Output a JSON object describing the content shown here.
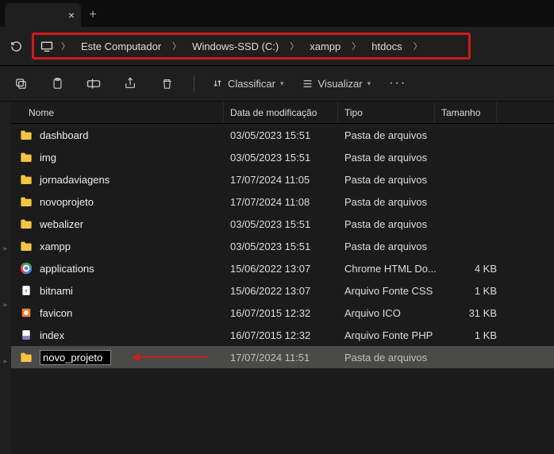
{
  "breadcrumbs": {
    "items": [
      "Este Computador",
      "Windows-SSD (C:)",
      "xampp",
      "htdocs"
    ]
  },
  "toolbar": {
    "sort_label": "Classificar",
    "view_label": "Visualizar"
  },
  "columns": {
    "name": "Nome",
    "date": "Data de modificação",
    "type": "Tipo",
    "size": "Tamanho"
  },
  "rows": [
    {
      "kind": "folder",
      "name": "dashboard",
      "date": "03/05/2023 15:51",
      "type": "Pasta de arquivos",
      "size": ""
    },
    {
      "kind": "folder",
      "name": "img",
      "date": "03/05/2023 15:51",
      "type": "Pasta de arquivos",
      "size": ""
    },
    {
      "kind": "folder",
      "name": "jornadaviagens",
      "date": "17/07/2024 11:05",
      "type": "Pasta de arquivos",
      "size": ""
    },
    {
      "kind": "folder",
      "name": "novoprojeto",
      "date": "17/07/2024 11:08",
      "type": "Pasta de arquivos",
      "size": ""
    },
    {
      "kind": "folder",
      "name": "webalizer",
      "date": "03/05/2023 15:51",
      "type": "Pasta de arquivos",
      "size": ""
    },
    {
      "kind": "folder",
      "name": "xampp",
      "date": "03/05/2023 15:51",
      "type": "Pasta de arquivos",
      "size": ""
    },
    {
      "kind": "chrome",
      "name": "applications",
      "date": "15/06/2022 13:07",
      "type": "Chrome HTML Do...",
      "size": "4 KB"
    },
    {
      "kind": "css",
      "name": "bitnami",
      "date": "15/06/2022 13:07",
      "type": "Arquivo Fonte CSS",
      "size": "1 KB"
    },
    {
      "kind": "ico",
      "name": "favicon",
      "date": "16/07/2015 12:32",
      "type": "Arquivo ICO",
      "size": "31 KB"
    },
    {
      "kind": "php",
      "name": "index",
      "date": "16/07/2015 12:32",
      "type": "Arquivo Fonte PHP",
      "size": "1 KB"
    }
  ],
  "editing_row": {
    "name": "novo_projeto",
    "date": "17/07/2024 11:51",
    "type": "Pasta de arquivos",
    "size": ""
  }
}
